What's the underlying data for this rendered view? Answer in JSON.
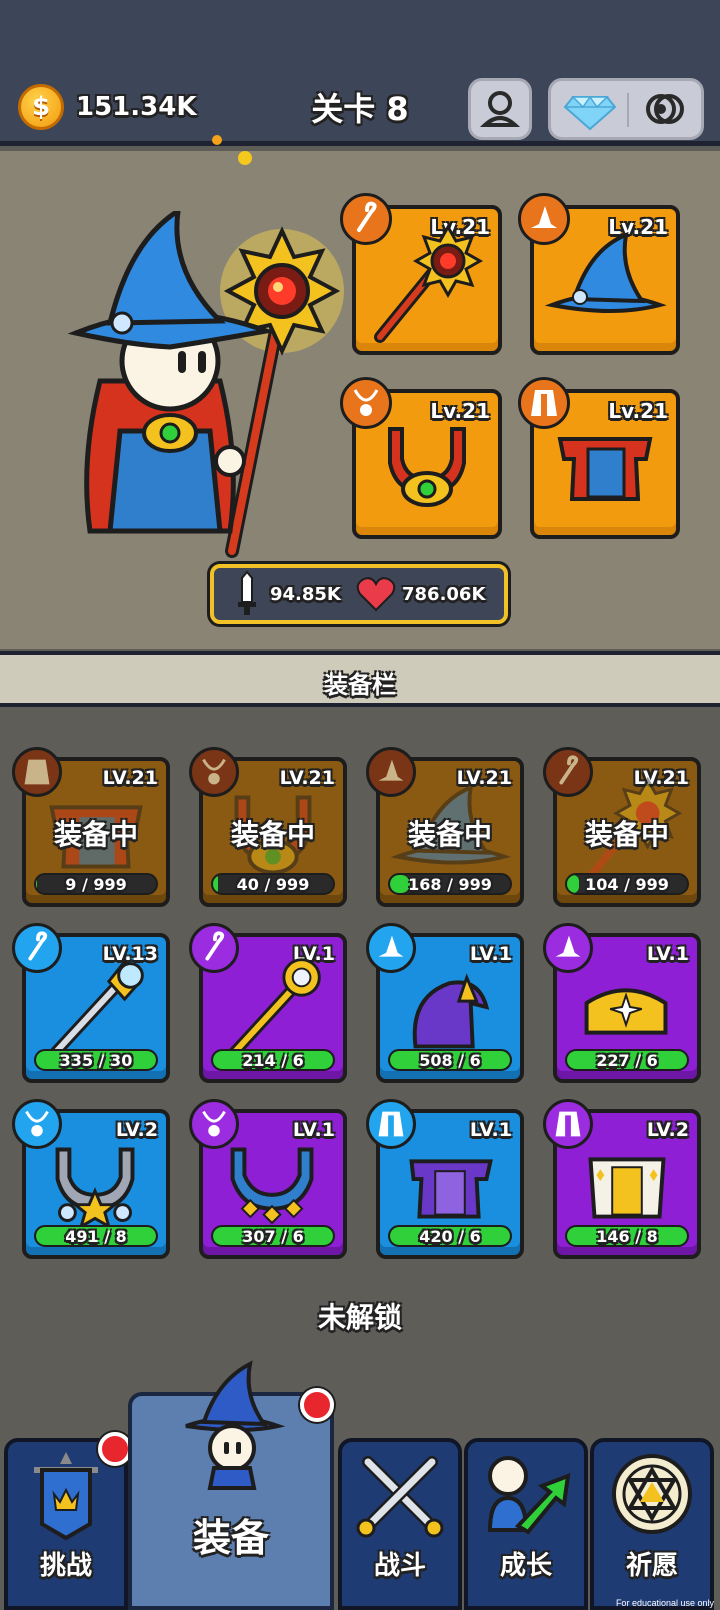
{
  "topbar": {
    "coins": "151.34K",
    "level_title": "关卡 8",
    "coin_icon": "dollar-coin-icon",
    "profile_icon": "profile-icon",
    "gem_icon": "diamond-icon",
    "settings_icon": "settings-icon"
  },
  "hero": {
    "slots": [
      {
        "name": "staff",
        "level": "Lv.21",
        "icon": "staff-icon"
      },
      {
        "name": "hat",
        "level": "Lv.21",
        "icon": "wizard-hat-icon"
      },
      {
        "name": "necklace",
        "level": "Lv.21",
        "icon": "necklace-icon"
      },
      {
        "name": "robe",
        "level": "Lv.21",
        "icon": "robe-icon"
      }
    ],
    "attack": "94.85K",
    "health": "786.06K"
  },
  "section_title": "装备栏",
  "equipped_label": "装备中",
  "inventory": {
    "equipped": [
      {
        "type": "robe",
        "level": "LV.21",
        "progress": "9 / 999",
        "fill": 0.01
      },
      {
        "type": "necklace",
        "level": "LV.21",
        "progress": "40 / 999",
        "fill": 0.04
      },
      {
        "type": "hat",
        "level": "LV.21",
        "progress": "168 / 999",
        "fill": 0.17
      },
      {
        "type": "staff",
        "level": "LV.21",
        "progress": "104 / 999",
        "fill": 0.1
      }
    ],
    "row2": [
      {
        "type": "staff",
        "rarity": "blue",
        "level": "LV.13",
        "progress": "335 / 30",
        "fill": 1.0
      },
      {
        "type": "staff",
        "rarity": "purple",
        "level": "LV.1",
        "progress": "214 / 6",
        "fill": 1.0
      },
      {
        "type": "hat",
        "rarity": "blue",
        "level": "LV.1",
        "progress": "508 / 6",
        "fill": 1.0
      },
      {
        "type": "hat",
        "rarity": "purple",
        "level": "LV.1",
        "progress": "227 / 6",
        "fill": 1.0
      }
    ],
    "row3": [
      {
        "type": "necklace",
        "rarity": "blue",
        "level": "LV.2",
        "progress": "491 / 8",
        "fill": 1.0
      },
      {
        "type": "necklace",
        "rarity": "purple",
        "level": "LV.1",
        "progress": "307 / 6",
        "fill": 1.0
      },
      {
        "type": "robe",
        "rarity": "blue",
        "level": "LV.1",
        "progress": "420 / 6",
        "fill": 1.0
      },
      {
        "type": "robe",
        "rarity": "purple",
        "level": "LV.2",
        "progress": "146 / 8",
        "fill": 1.0
      }
    ]
  },
  "locked_label": "未解锁",
  "nav": {
    "challenge": "挑战",
    "equipment": "装备",
    "battle": "战斗",
    "growth": "成长",
    "wish": "祈愿"
  },
  "watermark": "For educational use only"
}
